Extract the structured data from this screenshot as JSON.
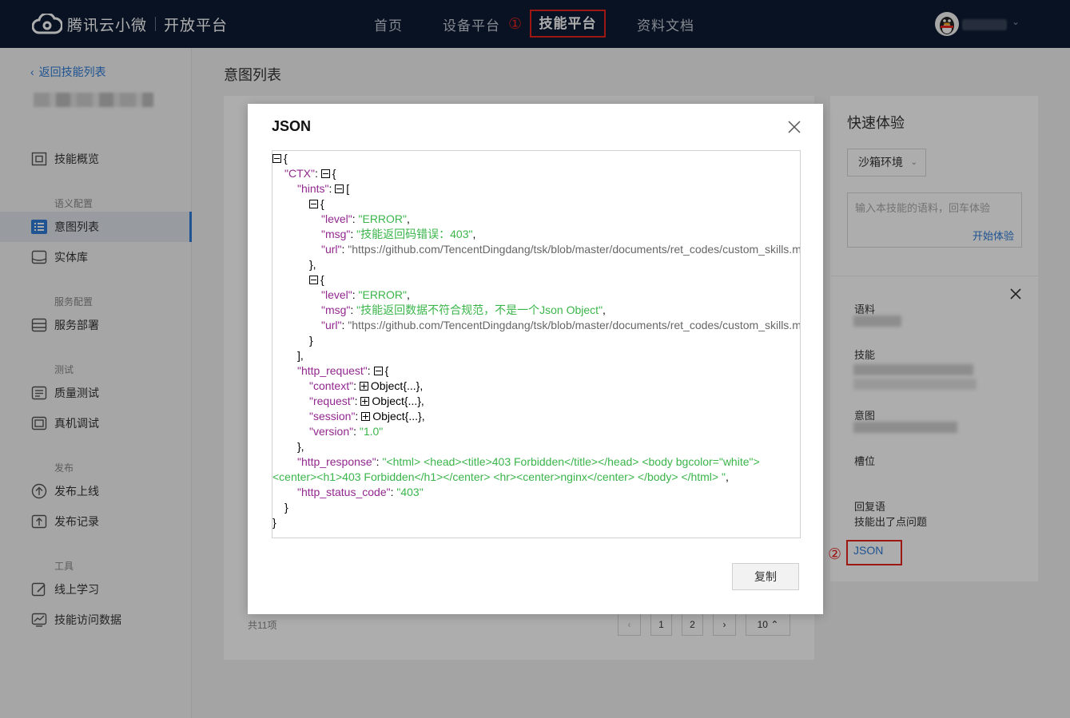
{
  "header": {
    "brand": "腾讯云小微",
    "sub_brand": "开放平台",
    "nav": [
      "首页",
      "设备平台",
      "技能平台",
      "资料文档"
    ],
    "active_nav": "技能平台",
    "marker1": "①"
  },
  "sidebar": {
    "back": "返回技能列表",
    "items": [
      {
        "label": "技能概览",
        "icon": "overview-icon"
      },
      {
        "group": "语义配置"
      },
      {
        "label": "意图列表",
        "icon": "list-icon",
        "active": true
      },
      {
        "label": "实体库",
        "icon": "entity-icon"
      },
      {
        "group": "服务配置"
      },
      {
        "label": "服务部署",
        "icon": "deploy-icon"
      },
      {
        "group": "测试"
      },
      {
        "label": "质量测试",
        "icon": "quality-icon"
      },
      {
        "label": "真机调试",
        "icon": "device-icon"
      },
      {
        "group": "发布"
      },
      {
        "label": "发布上线",
        "icon": "upload-icon"
      },
      {
        "label": "发布记录",
        "icon": "record-icon"
      },
      {
        "group": "工具"
      },
      {
        "label": "线上学习",
        "icon": "learn-icon"
      },
      {
        "label": "技能访问数据",
        "icon": "stats-icon"
      }
    ]
  },
  "main": {
    "title": "意图列表",
    "total": "共11项",
    "pager": {
      "prev": "‹",
      "pages": [
        "1",
        "2"
      ],
      "next": "›",
      "page_size": "10"
    }
  },
  "quick": {
    "title": "快速体验",
    "env": "沙箱环境",
    "placeholder": "输入本技能的语料，回车体验",
    "start": "开始体验",
    "labels": {
      "corpus": "语料",
      "skill": "技能",
      "intent": "意图",
      "slot": "槽位",
      "reply": "回复语"
    },
    "reply_value": "技能出了点问题",
    "json_link": "JSON",
    "marker2": "②"
  },
  "modal": {
    "title": "JSON",
    "copy": "复制",
    "lines": {
      "l1": "{",
      "ctx_k": "\"CTX\"",
      "ctx_o": "{",
      "hints_k": "\"hints\"",
      "hints_o": "[",
      "o1": "{",
      "level_k": "\"level\"",
      "level_v": "\"ERROR\"",
      "msg_k": "\"msg\"",
      "msg1_v": "\"技能返回码错误：403\"",
      "url_k": "\"url\"",
      "url_v": "\"https://github.com/TencentDingdang/tsk/blob/master/documents/ret_codes/custom_skills.m",
      "c1": "},",
      "o2": "{",
      "msg2_v": "\"技能返回数据不符合规范，不是一个Json Object\"",
      "c2": "}",
      "arr_c": "],",
      "req_k": "\"http_request\"",
      "req_o": "{",
      "context_k": "\"context\"",
      "request_k": "\"request\"",
      "session_k": "\"session\"",
      "obj": "Object{...}",
      "version_k": "\"version\"",
      "version_v": "\"1.0\"",
      "req_c": "},",
      "resp_k": "\"http_response\"",
      "resp_v1": "\"<html> <head><title>403 Forbidden</title></head> <body bgcolor=\"white\">",
      "resp_v2": "<center><h1>403 Forbidden</h1></center> <hr><center>nginx</center> </body> </html> \"",
      "status_k": "\"http_status_code\"",
      "status_v": "\"403\"",
      "ctx_c": "}",
      "end": "}"
    }
  }
}
